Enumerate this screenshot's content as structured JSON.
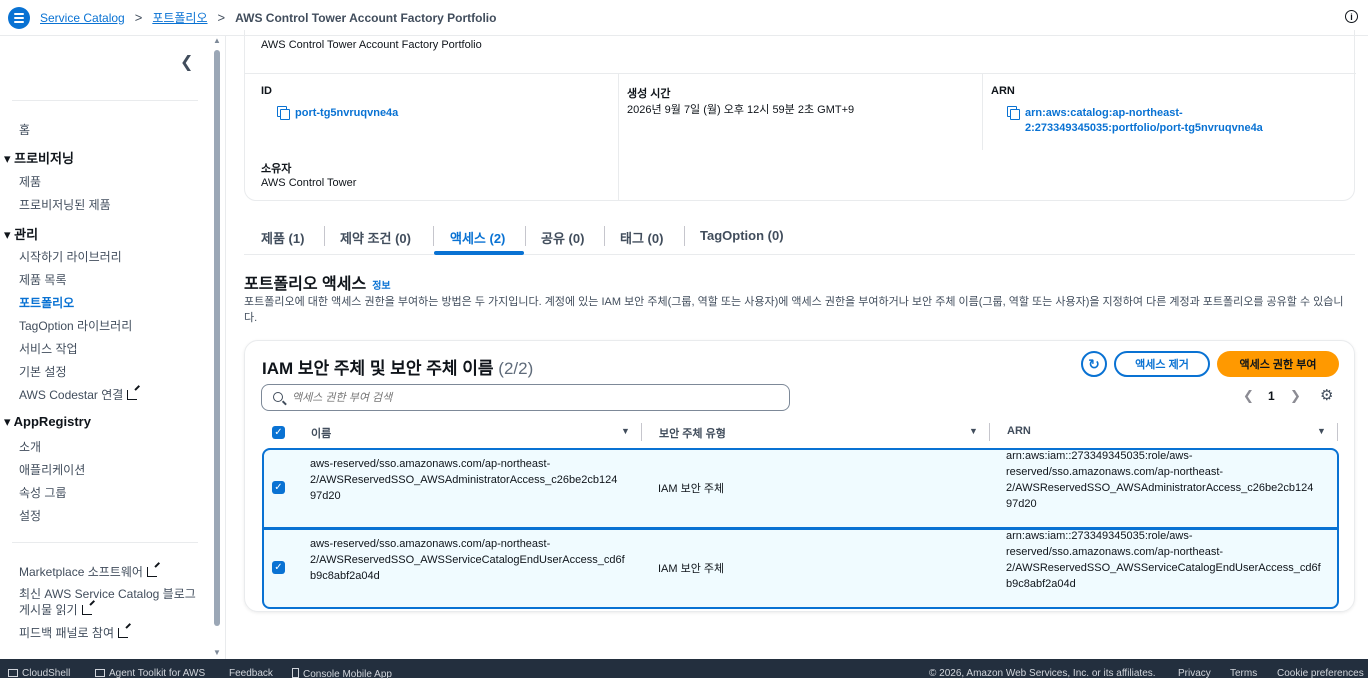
{
  "breadcrumb": {
    "service": "Service Catalog",
    "portfolios": "포트폴리오",
    "current": "AWS Control Tower Account Factory Portfolio"
  },
  "sidebar": {
    "home": "홈",
    "provisioning_header": "프로비저닝",
    "provisioning_items": [
      "제품",
      "프로비저닝된 제품"
    ],
    "admin_header": "관리",
    "admin_items": [
      "시작하기 라이브러리",
      "제품 목록",
      "포트폴리오",
      "TagOption 라이브러리",
      "서비스 작업",
      "기본 설정",
      "AWS Codestar 연결"
    ],
    "appregistry_header": "AppRegistry",
    "appregistry_items": [
      "소개",
      "애플리케이션",
      "속성 그룹",
      "설정"
    ],
    "bottom_links": [
      "Marketplace 소프트웨어",
      "최신 AWS Service Catalog 블로그",
      "게시물 읽기",
      "피드백 패널로 참여"
    ]
  },
  "details": {
    "description": "AWS Control Tower Account Factory Portfolio",
    "id_label": "ID",
    "id_value": "port-tg5nvruqvne4a",
    "created_label": "생성 시간",
    "created_value": "2026년 9월 7일 (월) 오후 12시 59분 2초 GMT+9",
    "arn_label": "ARN",
    "arn_line1": "arn:aws:catalog:ap-northeast-",
    "arn_line2": "2:273349345035:portfolio/port-tg5nvruqvne4a",
    "owner_label": "소유자",
    "owner_value": "AWS Control Tower"
  },
  "tabs": [
    "제품 (1)",
    "제약 조건 (0)",
    "액세스 (2)",
    "공유 (0)",
    "태그 (0)",
    "TagOption (0)"
  ],
  "access": {
    "title": "포트폴리오 액세스",
    "info": "정보",
    "description": "포트폴리오에 대한 액세스 권한을 부여하는 방법은 두 가지입니다. 계정에 있는 IAM 보안 주체(그룹, 역할 또는 사용자)에 액세스 권한을 부여하거나 보안 주체 이름(그룹, 역할 또는 사용자)을 지정하여 다른 계정과 포트폴리오를 공유할 수 있습니다."
  },
  "table": {
    "title": "IAM 보안 주체 및 보안 주체 이름",
    "count": "(2/2)",
    "remove_button": "액세스 제거",
    "grant_button": "액세스 권한 부여",
    "search_placeholder": "액세스 권한 부여 검색",
    "page": "1",
    "columns": [
      "이름",
      "보안 주체 유형",
      "ARN"
    ],
    "rows": [
      {
        "name": [
          "aws-reserved/sso.amazonaws.com/ap-northeast-",
          "2/AWSReservedSSO_AWSAdministratorAccess_c26be2cb124",
          "97d20"
        ],
        "type": "IAM 보안 주체",
        "arn": [
          "arn:aws:iam::273349345035:role/aws-",
          "reserved/sso.amazonaws.com/ap-northeast-",
          "2/AWSReservedSSO_AWSAdministratorAccess_c26be2cb124",
          "97d20"
        ]
      },
      {
        "name": [
          "aws-reserved/sso.amazonaws.com/ap-northeast-",
          "2/AWSReservedSSO_AWSServiceCatalogEndUserAccess_cd6f",
          "b9c8abf2a04d"
        ],
        "type": "IAM 보안 주체",
        "arn": [
          "arn:aws:iam::273349345035:role/aws-",
          "reserved/sso.amazonaws.com/ap-northeast-",
          "2/AWSReservedSSO_AWSServiceCatalogEndUserAccess_cd6f",
          "b9c8abf2a04d"
        ]
      }
    ]
  },
  "footer": {
    "cloudshell": "CloudShell",
    "agent_toolkit": "Agent Toolkit for AWS",
    "feedback": "Feedback",
    "mobile_app": "Console Mobile App",
    "copyright": "© 2026, Amazon Web Services, Inc. or its affiliates.",
    "privacy": "Privacy",
    "terms": "Terms",
    "cookies": "Cookie preferences"
  },
  "colors": {
    "accent": "#0972d3",
    "primary_button": "#ff9900",
    "footer_bg": "#232f3e",
    "selected_row_bg": "#f0fbff"
  }
}
